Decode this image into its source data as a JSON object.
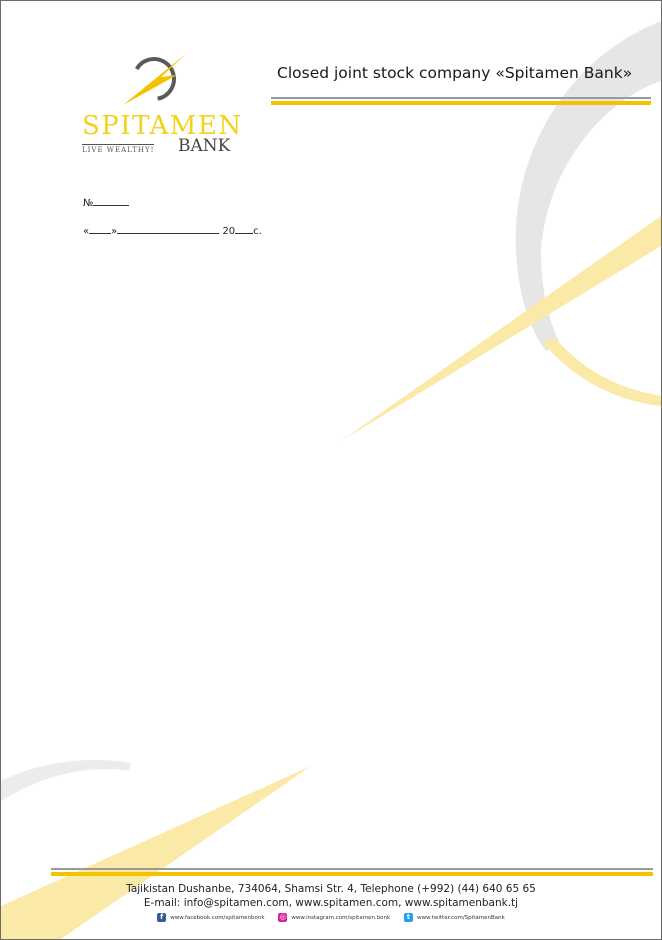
{
  "header": {
    "logo": {
      "wordmark": "SPITAMEN",
      "tagline": "LIVE WEALTHY!",
      "bank": "BANK"
    },
    "company_name": "Closed joint stock company «Spitamen Bank»"
  },
  "form": {
    "number_label": "№",
    "date_open_quote": "«",
    "date_close_quote": "»",
    "year_prefix": "20",
    "year_suffix": "с."
  },
  "footer": {
    "address": "Tajikistan Dushanbe, 734064, Shamsi Str. 4, Telephone (+992) (44) 640 65 65",
    "contacts": "E-mail: info@spitamen.com, www.spitamen.com, www.spitamenbank.tj",
    "social": [
      {
        "icon": "facebook-icon",
        "text": "www.facebook.com/spitamenbonk"
      },
      {
        "icon": "instagram-icon",
        "text": "www.instagram.com/spitamen.bonk"
      },
      {
        "icon": "twitter-icon",
        "text": "www.twitter.com/SpitamenBank"
      }
    ]
  },
  "colors": {
    "brand_gold": "#f4c300",
    "brand_gray": "#9a9a9a"
  }
}
